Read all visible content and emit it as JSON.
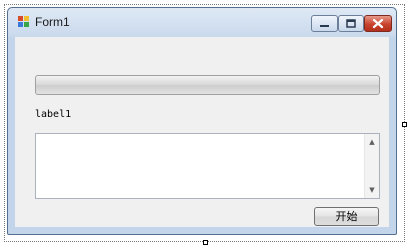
{
  "window": {
    "title": "Form1"
  },
  "controls": {
    "progress_value": 0,
    "label_text": "label1",
    "textbox_value": "",
    "start_button_label": "开始"
  }
}
